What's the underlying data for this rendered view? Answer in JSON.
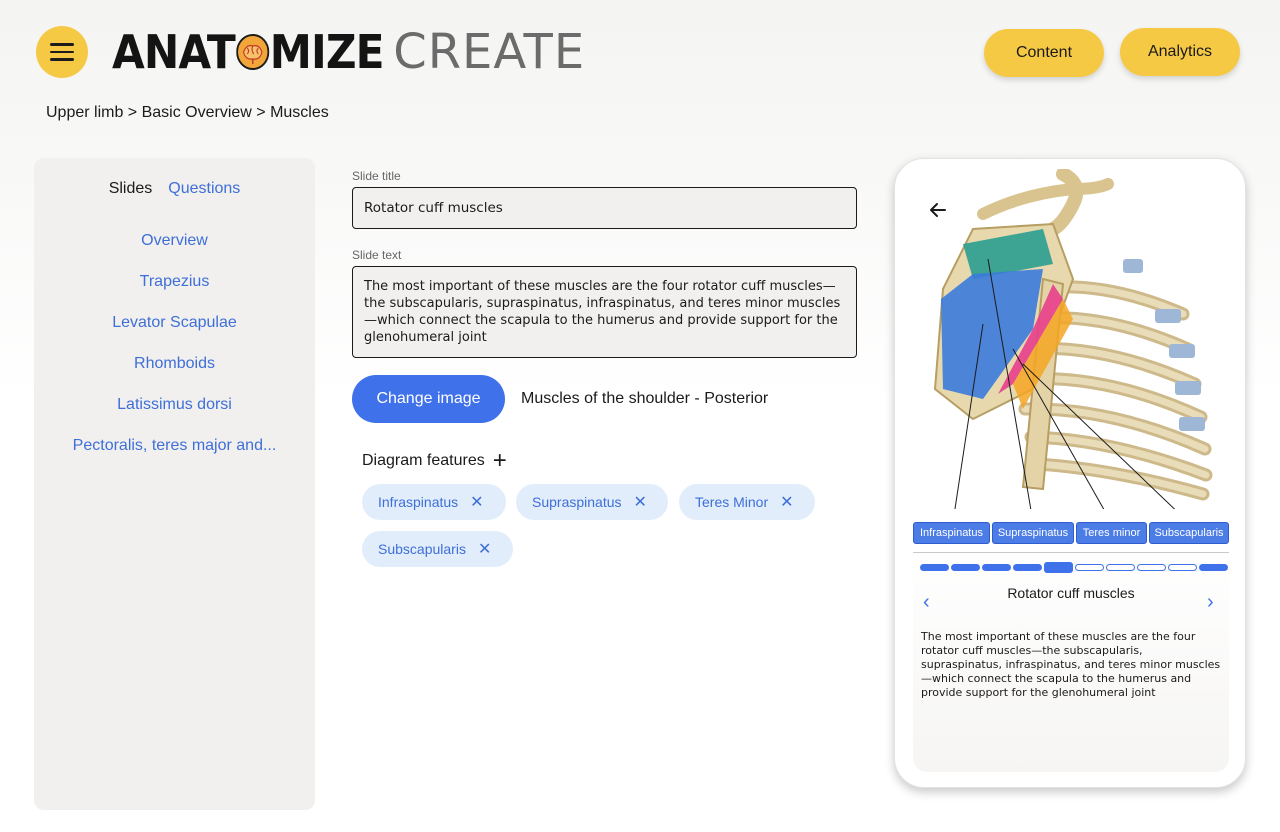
{
  "header": {
    "logo_bold": "ANAT",
    "logo_bold_2": "MIZE",
    "logo_light": "CREATE",
    "buttons": {
      "content": "Content",
      "analytics": "Analytics"
    }
  },
  "breadcrumb": "Upper limb > Basic Overview > Muscles",
  "sidebar": {
    "tabs": {
      "slides": "Slides",
      "questions": "Questions"
    },
    "items": [
      {
        "label": "Overview"
      },
      {
        "label": "Trapezius"
      },
      {
        "label": "Levator Scapulae"
      },
      {
        "label": "Rhomboids"
      },
      {
        "label": "Latissimus dorsi"
      },
      {
        "label": "Pectoralis, teres major and..."
      }
    ]
  },
  "editor": {
    "title_label": "Slide title",
    "title_value": "Rotator cuff muscles",
    "text_label": "Slide text",
    "text_value": "The most important of these muscles are the four rotator cuff muscles—the subscapularis, supraspinatus, infraspinatus, and teres minor muscles—which connect the scapula to the humerus and provide support for the glenohumeral joint",
    "change_image_label": "Change image",
    "image_name": "Muscles of the shoulder - Posterior",
    "features_label": "Diagram features",
    "features": [
      {
        "label": "Infraspinatus"
      },
      {
        "label": "Supraspinatus"
      },
      {
        "label": "Teres Minor"
      },
      {
        "label": "Subscapularis"
      }
    ]
  },
  "preview": {
    "tags": [
      {
        "label": "Infraspinatus"
      },
      {
        "label": "Supraspinatus"
      },
      {
        "label": "Teres minor"
      },
      {
        "label": "Subscapularis"
      }
    ],
    "progress": {
      "total": 10,
      "current": 5
    },
    "title": "Rotator cuff muscles",
    "text": "The most important of these muscles are the four rotator cuff muscles—the subscapularis, supraspinatus, infraspinatus, and teres minor muscles—which connect the scapula to the humerus and provide support for the glenohumeral joint"
  },
  "colors": {
    "accent_yellow": "#f6c945",
    "primary_blue": "#3f72ea",
    "link_blue": "#3e6fd8",
    "chip_bg": "#e2edfb"
  }
}
